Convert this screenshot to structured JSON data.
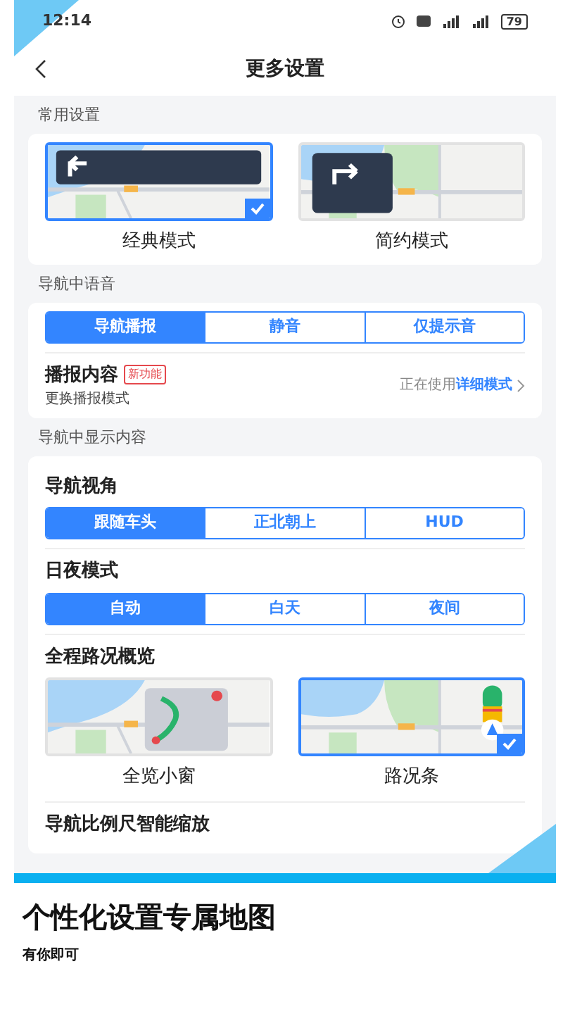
{
  "status_bar": {
    "time": "12:14",
    "battery": "79"
  },
  "header": {
    "title": "更多设置"
  },
  "sections": [
    {
      "title": "常用设置",
      "items": [
        {
          "kind": "cards",
          "options": [
            {
              "label": "经典模式",
              "selected": true
            },
            {
              "label": "简约模式",
              "selected": false
            }
          ]
        }
      ]
    },
    {
      "title": "导航中语音",
      "items": [
        {
          "kind": "segmented",
          "options": [
            {
              "label": "导航播报",
              "selected": true
            },
            {
              "label": "静音",
              "selected": false
            },
            {
              "label": "仅提示音",
              "selected": false
            }
          ]
        },
        {
          "kind": "link_row",
          "title": "播报内容",
          "badge": "新功能",
          "subtitle": "更换播报模式",
          "value_prefix": "正在使用",
          "value": "详细模式"
        }
      ]
    },
    {
      "title": "导航中显示内容",
      "items": [
        {
          "kind": "segmented",
          "title": "导航视角",
          "options": [
            {
              "label": "跟随车头",
              "selected": true
            },
            {
              "label": "正北朝上",
              "selected": false
            },
            {
              "label": "HUD",
              "selected": false
            }
          ]
        },
        {
          "kind": "segmented",
          "title": "日夜模式",
          "options": [
            {
              "label": "自动",
              "selected": true
            },
            {
              "label": "白天",
              "selected": false
            },
            {
              "label": "夜间",
              "selected": false
            }
          ]
        },
        {
          "kind": "cards",
          "title": "全程路况概览",
          "options": [
            {
              "label": "全览小窗",
              "selected": false
            },
            {
              "label": "路况条",
              "selected": true
            }
          ]
        },
        {
          "kind": "plain",
          "title": "导航比例尺智能缩放"
        }
      ]
    }
  ],
  "caption": {
    "title": "个性化设置专属地图",
    "subtitle": "有你即可"
  }
}
